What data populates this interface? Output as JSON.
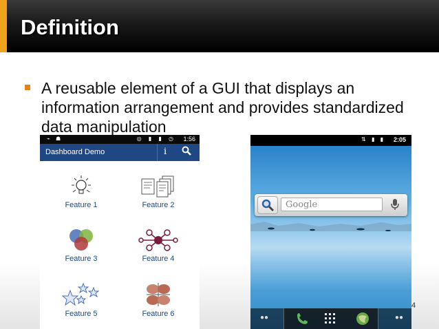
{
  "slide": {
    "title": "Definition",
    "bullet": "A reusable element of a GUI that displays an information arrangement and provides standardized data manipulation",
    "page_number": "4"
  },
  "phone_left": {
    "status_time": "1:56",
    "app_title": "Dashboard Demo",
    "info_icon": "i",
    "features": [
      "Feature 1",
      "Feature 2",
      "Feature 3",
      "Feature 4",
      "Feature 5",
      "Feature 6"
    ]
  },
  "phone_right": {
    "status_time": "2:05",
    "search_placeholder": "Google"
  },
  "colors": {
    "title_accent": "#f0a21c",
    "bullet": "#e8821c",
    "app_bar": "#1e4784"
  }
}
